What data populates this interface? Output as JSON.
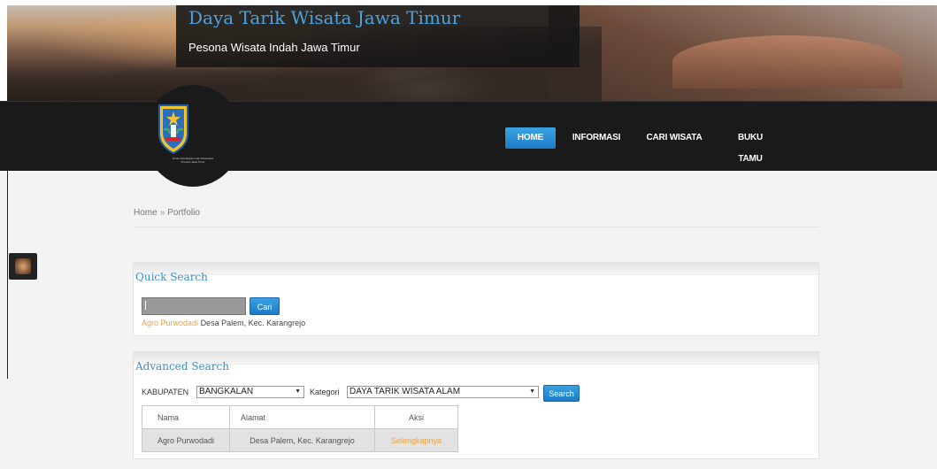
{
  "header": {
    "site_title": "Daya Tarik Wisata Jawa Timur",
    "site_subtitle": "Pesona Wisata Indah Jawa Timur",
    "logo_caption_line1": "Dinas Kebudayaan dan Pariwisata",
    "logo_caption_line2": "Provinsi Jawa Timur"
  },
  "nav": {
    "items": [
      {
        "label": "HOME",
        "active": true
      },
      {
        "label": "INFORMASI",
        "active": false
      },
      {
        "label": "CARI WISATA",
        "active": false
      },
      {
        "label": "BUKU TAMU",
        "active": false
      }
    ]
  },
  "breadcrumb": {
    "home": "Home",
    "separator": "»",
    "current": "Portfolio"
  },
  "quick_search": {
    "title": "Quick Search",
    "input_value": "",
    "button_label": "Cari",
    "result_link": "Agro Purwodadi",
    "result_address": "Desa Palem, Kec. Karangrejo"
  },
  "advanced_search": {
    "title": "Advanced Search",
    "kabupaten_label": "KABUPATEN",
    "kabupaten_value": "BANGKALAN",
    "kategori_label": "Kategori",
    "kategori_value": "DAYA TARIK WISATA ALAM",
    "button_label": "Search",
    "table": {
      "headers": [
        "Nama",
        "Alamat",
        "Aksi"
      ],
      "rows": [
        [
          "Agro Purwodadi",
          "Desa Palem, Kec. Karangrejo",
          "Selengkapnya"
        ]
      ]
    }
  },
  "colors": {
    "accent": "#2b8fd6",
    "link_orange": "#e8a33d",
    "title_blue": "#4aa3df",
    "navbar_bg": "#1a1a1a"
  }
}
